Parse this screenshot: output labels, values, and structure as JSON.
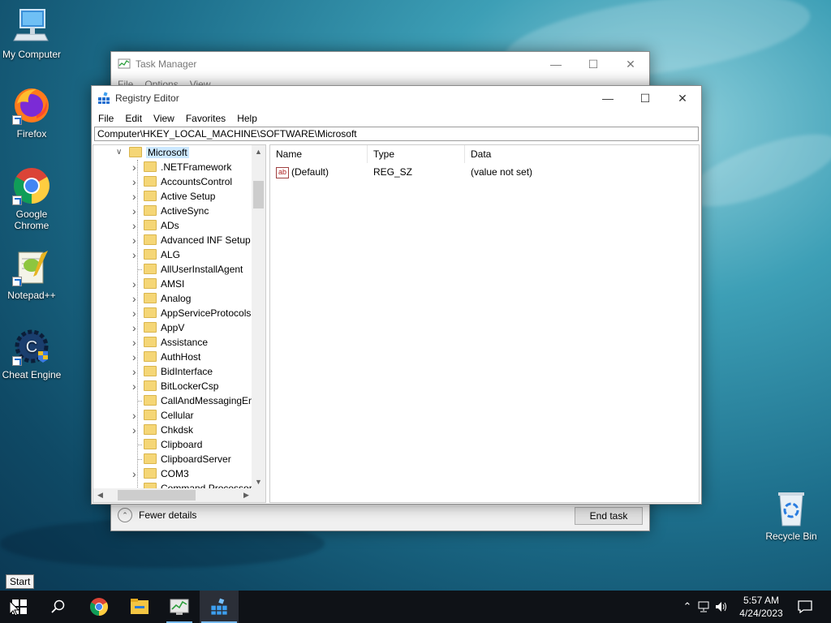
{
  "desktop": {
    "icons": [
      {
        "label": "My Computer"
      },
      {
        "label": "Firefox"
      },
      {
        "label": "Google Chrome"
      },
      {
        "label": "Notepad++"
      },
      {
        "label": "Cheat Engine"
      },
      {
        "label": "Recycle Bin"
      }
    ]
  },
  "task_manager": {
    "title": "Task Manager",
    "menu": [
      "File",
      "Options",
      "View"
    ],
    "fewer_details": "Fewer details",
    "end_task": "End task"
  },
  "registry_editor": {
    "title": "Registry Editor",
    "menu": [
      "File",
      "Edit",
      "View",
      "Favorites",
      "Help"
    ],
    "address": "Computer\\HKEY_LOCAL_MACHINE\\SOFTWARE\\Microsoft",
    "tree_root": "Microsoft",
    "tree_items": [
      {
        "label": ".NETFramework",
        "expandable": true
      },
      {
        "label": "AccountsControl",
        "expandable": true
      },
      {
        "label": "Active Setup",
        "expandable": true
      },
      {
        "label": "ActiveSync",
        "expandable": true
      },
      {
        "label": "ADs",
        "expandable": true
      },
      {
        "label": "Advanced INF Setup",
        "expandable": true
      },
      {
        "label": "ALG",
        "expandable": true
      },
      {
        "label": "AllUserInstallAgent",
        "expandable": false
      },
      {
        "label": "AMSI",
        "expandable": true
      },
      {
        "label": "Analog",
        "expandable": true
      },
      {
        "label": "AppServiceProtocols",
        "expandable": true
      },
      {
        "label": "AppV",
        "expandable": true
      },
      {
        "label": "Assistance",
        "expandable": true
      },
      {
        "label": "AuthHost",
        "expandable": true
      },
      {
        "label": "BidInterface",
        "expandable": true
      },
      {
        "label": "BitLockerCsp",
        "expandable": true
      },
      {
        "label": "CallAndMessagingEnh",
        "expandable": false
      },
      {
        "label": "Cellular",
        "expandable": true
      },
      {
        "label": "Chkdsk",
        "expandable": true
      },
      {
        "label": "Clipboard",
        "expandable": false
      },
      {
        "label": "ClipboardServer",
        "expandable": false
      },
      {
        "label": "COM3",
        "expandable": true
      },
      {
        "label": "Command Processor",
        "expandable": false
      }
    ],
    "columns": {
      "name": "Name",
      "type": "Type",
      "data": "Data"
    },
    "values": [
      {
        "name": "(Default)",
        "type": "REG_SZ",
        "data": "(value not set)"
      }
    ],
    "value_icon_text": "ab"
  },
  "taskbar": {
    "start_tooltip": "Start",
    "time": "5:57 AM",
    "date": "4/24/2023"
  }
}
